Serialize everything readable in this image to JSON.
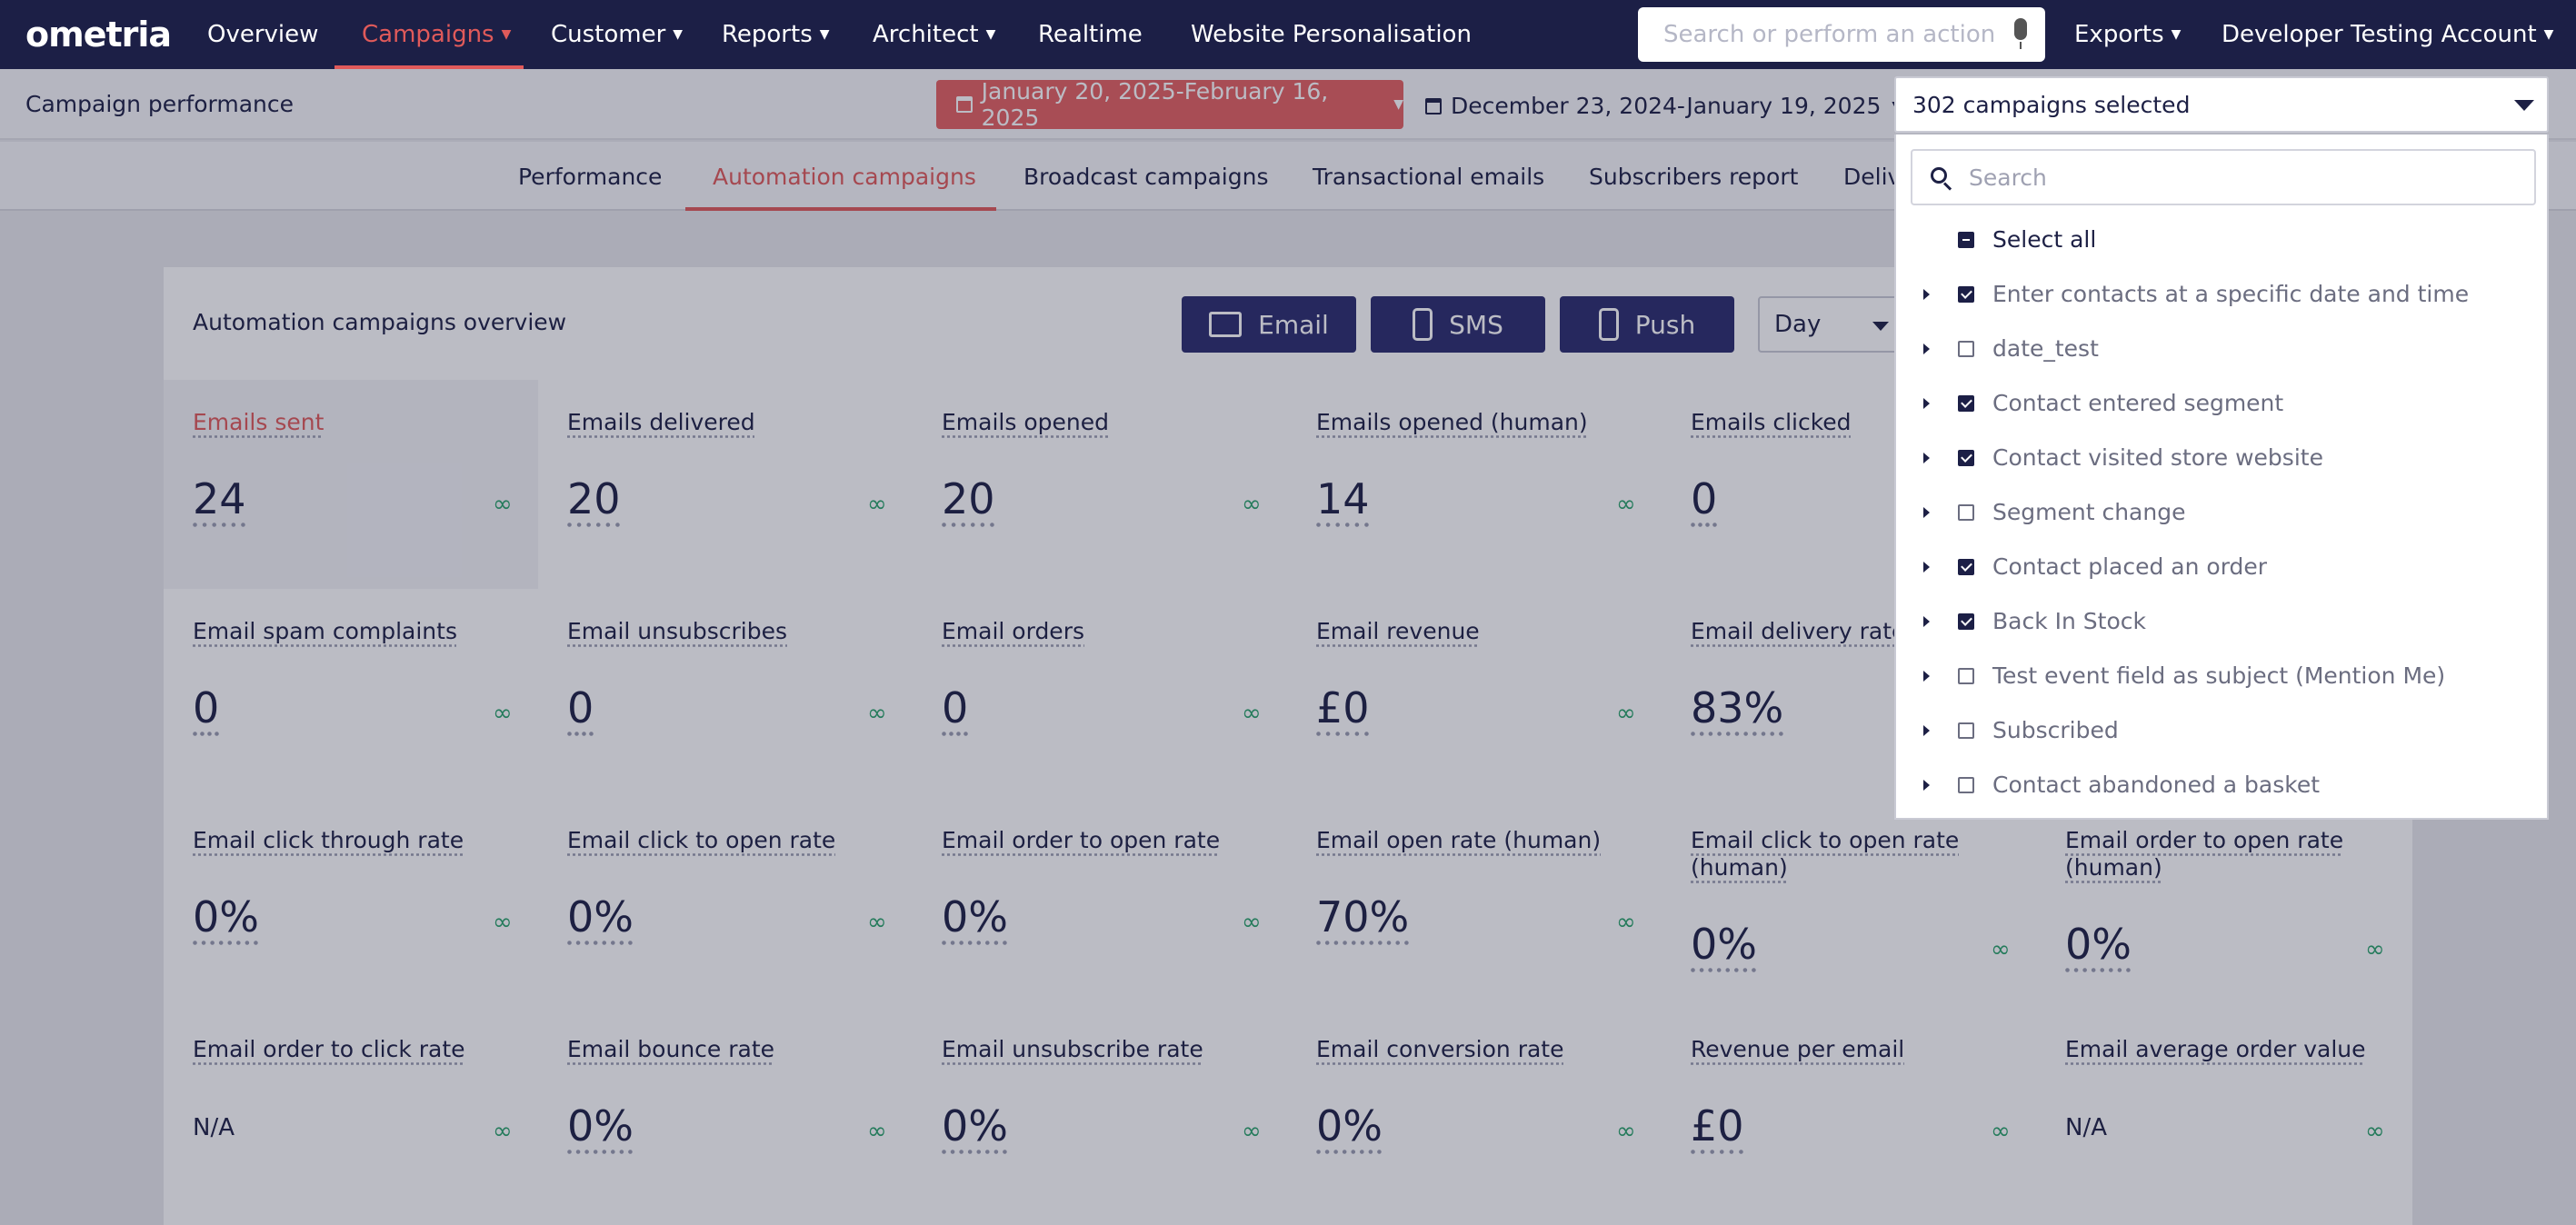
{
  "nav": {
    "logo": "ometria",
    "items": [
      {
        "label": "Overview",
        "caret": false
      },
      {
        "label": "Campaigns",
        "caret": true
      },
      {
        "label": "Customer",
        "caret": true
      },
      {
        "label": "Reports",
        "caret": true
      },
      {
        "label": "Architect",
        "caret": true
      },
      {
        "label": "Realtime",
        "caret": false
      },
      {
        "label": "Website Personalisation",
        "caret": false
      }
    ],
    "active": "Campaigns",
    "search_placeholder": "Search or perform an action",
    "exports": "Exports",
    "account": "Developer Testing Account"
  },
  "subheader": {
    "title": "Campaign performance",
    "date_range": "January 20, 2025-February 16, 2025",
    "compare_range": "December 23, 2024-January 19, 2025"
  },
  "tabs": [
    "Performance",
    "Automation campaigns",
    "Broadcast campaigns",
    "Transactional emails",
    "Subscribers report",
    "Deliv"
  ],
  "active_tab": "Automation campaigns",
  "card": {
    "title": "Automation campaigns overview",
    "channels": [
      "Email",
      "SMS",
      "Push"
    ],
    "period": "Day"
  },
  "metrics": [
    {
      "label": "Emails sent",
      "value": "24"
    },
    {
      "label": "Emails delivered",
      "value": "20"
    },
    {
      "label": "Emails opened",
      "value": "20"
    },
    {
      "label": "Emails opened (human)",
      "value": "14"
    },
    {
      "label": "Emails clicked",
      "value": "0"
    },
    {
      "label": "Email spam complaints",
      "value": "0"
    },
    {
      "label": "Email unsubscribes",
      "value": "0"
    },
    {
      "label": "Email orders",
      "value": "0"
    },
    {
      "label": "Email revenue",
      "value": "£0"
    },
    {
      "label": "Email delivery rate",
      "value": "83%"
    },
    {
      "label": "Email click through rate",
      "value": "0%"
    },
    {
      "label": "Email click to open rate",
      "value": "0%"
    },
    {
      "label": "Email order to open rate",
      "value": "0%"
    },
    {
      "label": "Email open rate (human)",
      "value": "70%"
    },
    {
      "label": "Email click to open rate (human)",
      "value": "0%"
    },
    {
      "label": "Email order to open rate (human)",
      "value": "0%"
    },
    {
      "label": "Email order to click rate",
      "value": "N/A"
    },
    {
      "label": "Email bounce rate",
      "value": "0%"
    },
    {
      "label": "Email unsubscribe rate",
      "value": "0%"
    },
    {
      "label": "Email conversion rate",
      "value": "0%"
    },
    {
      "label": "Revenue per email",
      "value": "£0"
    },
    {
      "label": "Email average order value",
      "value": "N/A"
    }
  ],
  "infinity": "∞",
  "campaign_select": {
    "summary": "302 campaigns selected",
    "search_placeholder": "Search",
    "select_all": "Select all",
    "options": [
      {
        "label": "Enter contacts at a specific date and time",
        "checked": true
      },
      {
        "label": "date_test",
        "checked": false
      },
      {
        "label": "Contact entered segment",
        "checked": true
      },
      {
        "label": "Contact visited store website",
        "checked": true
      },
      {
        "label": "Segment change",
        "checked": false
      },
      {
        "label": "Contact placed an order",
        "checked": true
      },
      {
        "label": "Back In Stock",
        "checked": true
      },
      {
        "label": "Test event field as subject (Mention Me)",
        "checked": false
      },
      {
        "label": "Subscribed",
        "checked": false
      },
      {
        "label": "Contact abandoned a basket",
        "checked": false
      }
    ]
  }
}
